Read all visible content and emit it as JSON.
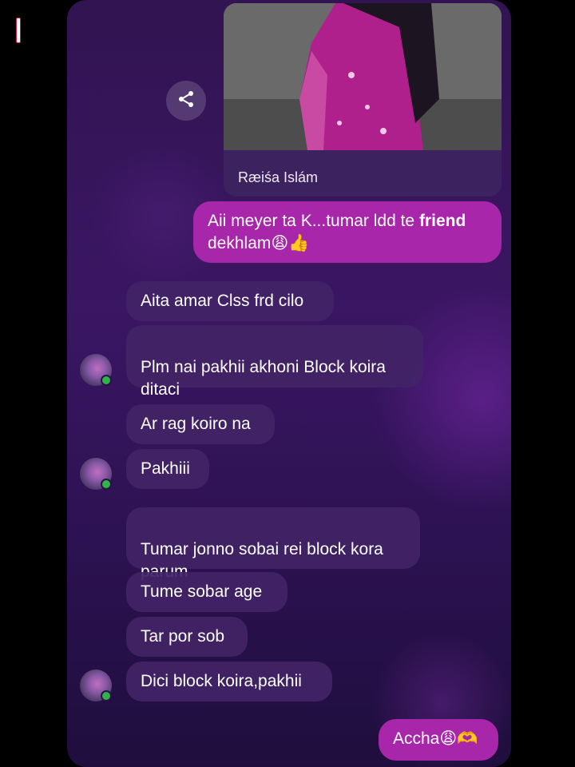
{
  "link_preview": {
    "title": "Ræiśa Islám"
  },
  "messages": [
    {
      "text": "Aii meyer ta K...tumar ldd te ",
      "bold": "friend",
      "text2": "dekhlam😩👍"
    },
    {
      "text": "Aita amar Clss frd cilo"
    },
    {
      "text": "Plm nai pakhii akhoni Block koira\nditaci"
    },
    {
      "text": "Ar rag koiro na"
    },
    {
      "text": "Pakhiii"
    },
    {
      "text": "Tumar jonno sobai rei block kora\nparum"
    },
    {
      "text": "Tume sobar age"
    },
    {
      "text": "Tar por sob"
    },
    {
      "text": "Dici block koira,pakhii"
    },
    {
      "text": "Accha😩🫶"
    }
  ],
  "colors": {
    "outgoing_bubble": "#a726a9",
    "incoming_bubble": "#42246a",
    "online_dot": "#31b24a"
  }
}
